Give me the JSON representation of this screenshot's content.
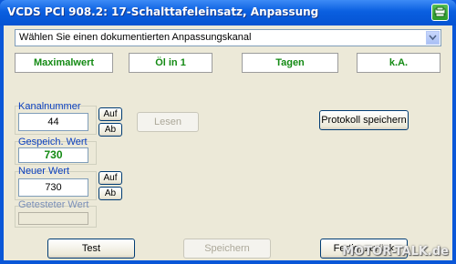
{
  "window": {
    "title": "VCDS PCI 908.2: 17-Schalttafeleinsatz,  Anpassung"
  },
  "channel_select": {
    "value": "Wählen Sie einen dokumentierten Anpassungskanal"
  },
  "value_boxes": [
    "Maximalwert",
    "Öl in 1",
    "Tagen",
    "k.A."
  ],
  "kanal": {
    "label": "Kanalnummer",
    "value": "44",
    "up_label": "Auf",
    "down_label": "Ab"
  },
  "gespeich": {
    "label": "Gespeich. Wert",
    "value": "730"
  },
  "neuer": {
    "label": "Neuer Wert",
    "value": "730",
    "up_label": "Auf",
    "down_label": "Ab"
  },
  "getestet": {
    "label": "Getesteter Wert",
    "value": ""
  },
  "buttons": {
    "lesen": "Lesen",
    "protokoll": "Protokoll speichern",
    "test": "Test",
    "speichern": "Speichern",
    "fertig": "Fertig, zurück"
  },
  "watermark": "MOTOR-TALK.de",
  "colors": {
    "titlebar": "#0a5fe0",
    "value_text": "#138a13",
    "label_text": "#0a3fbf",
    "client_bg": "#ece9d8"
  },
  "icons": {
    "window_button": "green-app-icon",
    "dropdown": "chevron-down-icon"
  }
}
